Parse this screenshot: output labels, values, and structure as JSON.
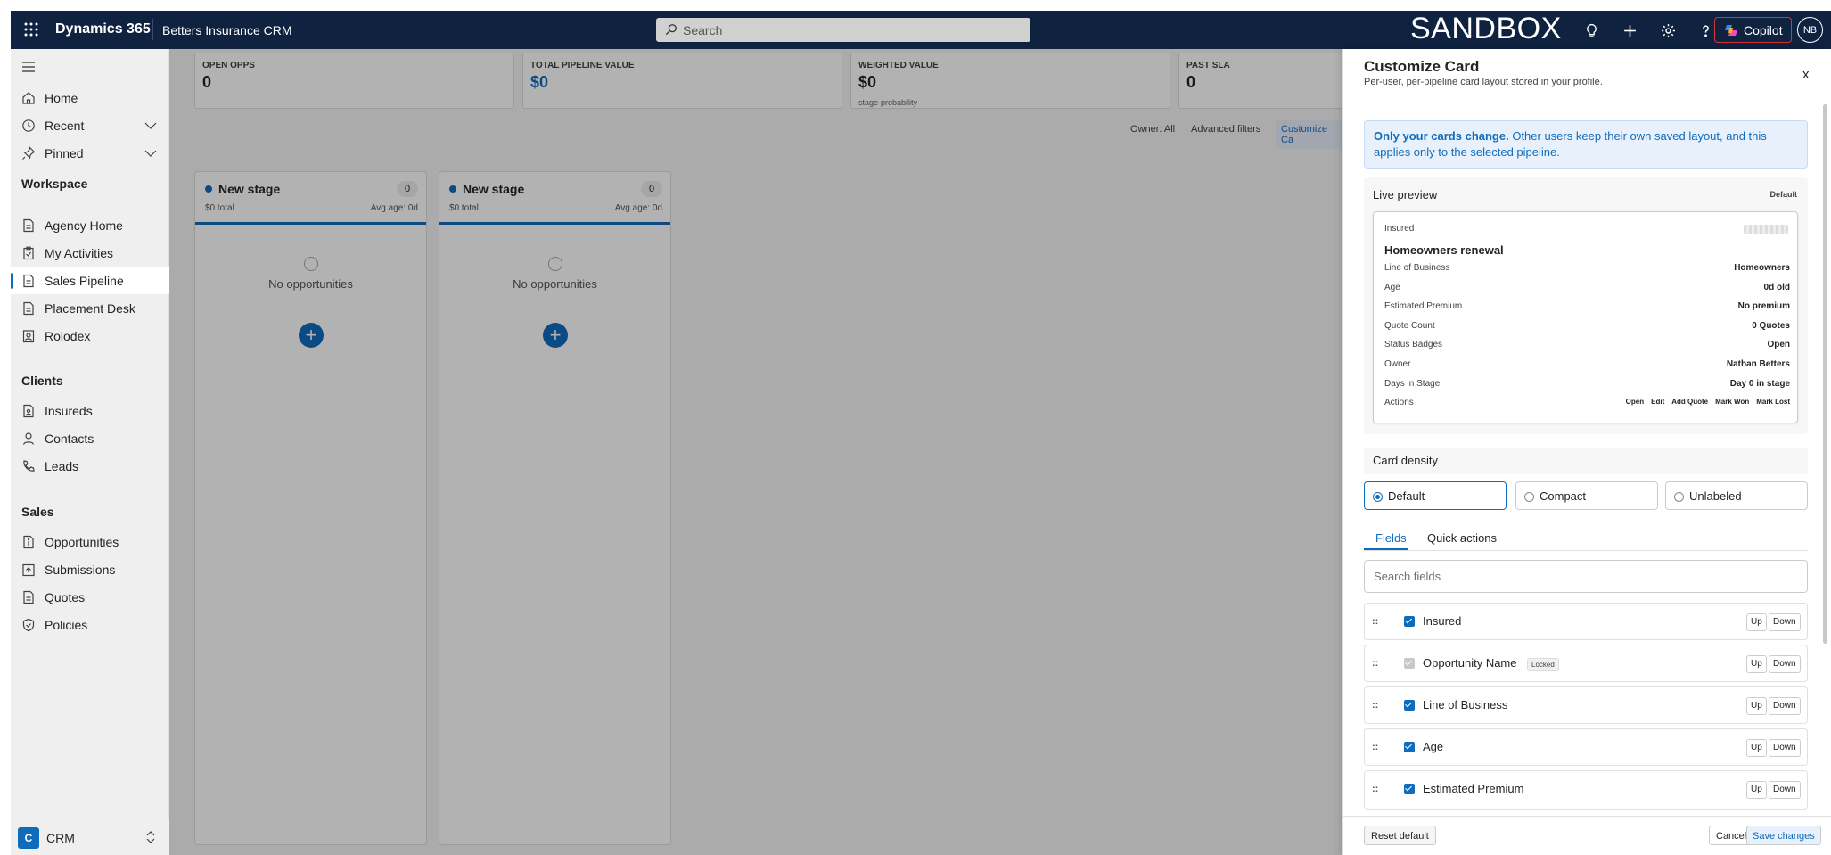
{
  "topbar": {
    "brand": "Dynamics 365",
    "app_name": "Betters Insurance CRM",
    "search_placeholder": "Search",
    "environment": "SANDBOX",
    "copilot_label": "Copilot",
    "avatar_initials": "NB"
  },
  "sidebar": {
    "items_top": [
      {
        "label": "Home",
        "icon": "home-icon"
      },
      {
        "label": "Recent",
        "icon": "clock-icon"
      },
      {
        "label": "Pinned",
        "icon": "pin-icon"
      }
    ],
    "sections": [
      {
        "title": "Workspace",
        "items": [
          "Agency Home",
          "My Activities",
          "Sales Pipeline",
          "Placement Desk",
          "Rolodex"
        ]
      },
      {
        "title": "Clients",
        "items": [
          "Insureds",
          "Contacts",
          "Leads"
        ]
      },
      {
        "title": "Sales",
        "items": [
          "Opportunities",
          "Submissions",
          "Quotes",
          "Policies"
        ]
      }
    ],
    "active_item": "Sales Pipeline",
    "area": {
      "badge": "C",
      "name": "CRM"
    }
  },
  "kpis": [
    {
      "label": "OPEN OPPS",
      "value": "0",
      "sub": ""
    },
    {
      "label": "TOTAL PIPELINE VALUE",
      "value": "$0",
      "sub": ""
    },
    {
      "label": "WEIGHTED VALUE",
      "value": "$0",
      "sub": "stage-probability"
    },
    {
      "label": "PAST SLA",
      "value": "0",
      "sub": ""
    }
  ],
  "filters": {
    "owner": "Owner: All",
    "advanced": "Advanced filters",
    "customize": "Customize Ca"
  },
  "stages": [
    {
      "name": "New stage",
      "count": "0",
      "total": "$0 total",
      "avg_age": "Avg age: 0d",
      "empty": "No opportunities"
    },
    {
      "name": "New stage",
      "count": "0",
      "total": "$0 total",
      "avg_age": "Avg age: 0d",
      "empty": "No opportunities"
    }
  ],
  "panel": {
    "title": "Customize Card",
    "subtitle": "Per-user, per-pipeline card layout stored in your profile.",
    "close": "x",
    "notice_bold": "Only your cards change.",
    "notice_text": " Other users keep their own saved layout, and this applies only to the selected pipeline.",
    "preview": {
      "heading": "Live preview",
      "badge": "Default",
      "insured_label": "Insured",
      "opportunity_name": "Homeowners renewal",
      "rows": [
        {
          "k": "Line of Business",
          "v": "Homeowners"
        },
        {
          "k": "Age",
          "v": "0d old"
        },
        {
          "k": "Estimated Premium",
          "v": "No premium"
        },
        {
          "k": "Quote Count",
          "v": "0 Quotes"
        },
        {
          "k": "Status Badges",
          "v": "Open"
        },
        {
          "k": "Owner",
          "v": "Nathan Betters"
        },
        {
          "k": "Days in Stage",
          "v": "Day 0 in stage"
        }
      ],
      "actions_label": "Actions",
      "actions": [
        "Open",
        "Edit",
        "Add Quote",
        "Mark Won",
        "Mark Lost"
      ]
    },
    "density": {
      "heading": "Card density",
      "options": [
        "Default",
        "Compact",
        "Unlabeled"
      ],
      "selected": "Default"
    },
    "tabs": {
      "fields": "Fields",
      "quick_actions": "Quick actions"
    },
    "search_fields_placeholder": "Search fields",
    "fields": [
      {
        "name": "Insured",
        "checked": true,
        "locked": false
      },
      {
        "name": "Opportunity Name",
        "checked": true,
        "locked": true
      },
      {
        "name": "Line of Business",
        "checked": true,
        "locked": false
      },
      {
        "name": "Age",
        "checked": true,
        "locked": false
      },
      {
        "name": "Estimated Premium",
        "checked": true,
        "locked": false
      }
    ],
    "grip": "::",
    "locked_label": "Locked",
    "up_label": "Up",
    "down_label": "Down",
    "footer": {
      "reset": "Reset default",
      "cancel": "Cancel",
      "save": "Save changes"
    }
  },
  "colors": {
    "topbar": "#0f2240",
    "accent": "#0f6cbd",
    "copilot_border": "#d13438"
  }
}
